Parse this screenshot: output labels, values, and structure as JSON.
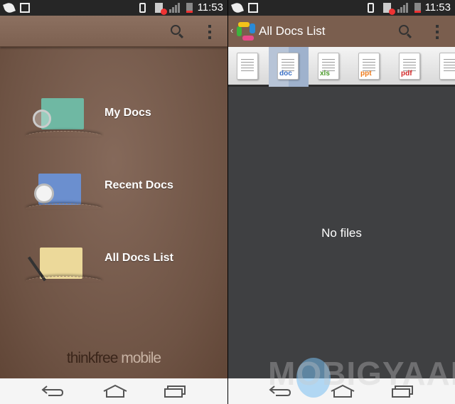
{
  "status_bar": {
    "time": "11:53"
  },
  "left": {
    "menu": [
      {
        "label": "My Docs",
        "color": "#6fb8a3"
      },
      {
        "label": "Recent Docs",
        "color": "#6b8fcf"
      },
      {
        "label": "All Docs List",
        "color": "#ecd99a"
      }
    ],
    "brand": {
      "part1": "thinkfree",
      "part2": "mobile"
    }
  },
  "right": {
    "title": "All Docs List",
    "tabs": [
      {
        "ext": "",
        "color": "#999"
      },
      {
        "ext": "doc",
        "color": "#3a6fc5"
      },
      {
        "ext": "xls",
        "color": "#4a9a2a"
      },
      {
        "ext": "ppt",
        "color": "#ee7a1a"
      },
      {
        "ext": "pdf",
        "color": "#d22a2a"
      },
      {
        "ext": "",
        "color": "#2a6ad0"
      }
    ],
    "selected_tab": "doc",
    "empty_text": "No files"
  },
  "watermark": "MOBIGYAAN",
  "colors": {
    "leather": "#7a5e4c",
    "content_bg": "#3f4042",
    "selected_tab": "#a9b9d1"
  }
}
